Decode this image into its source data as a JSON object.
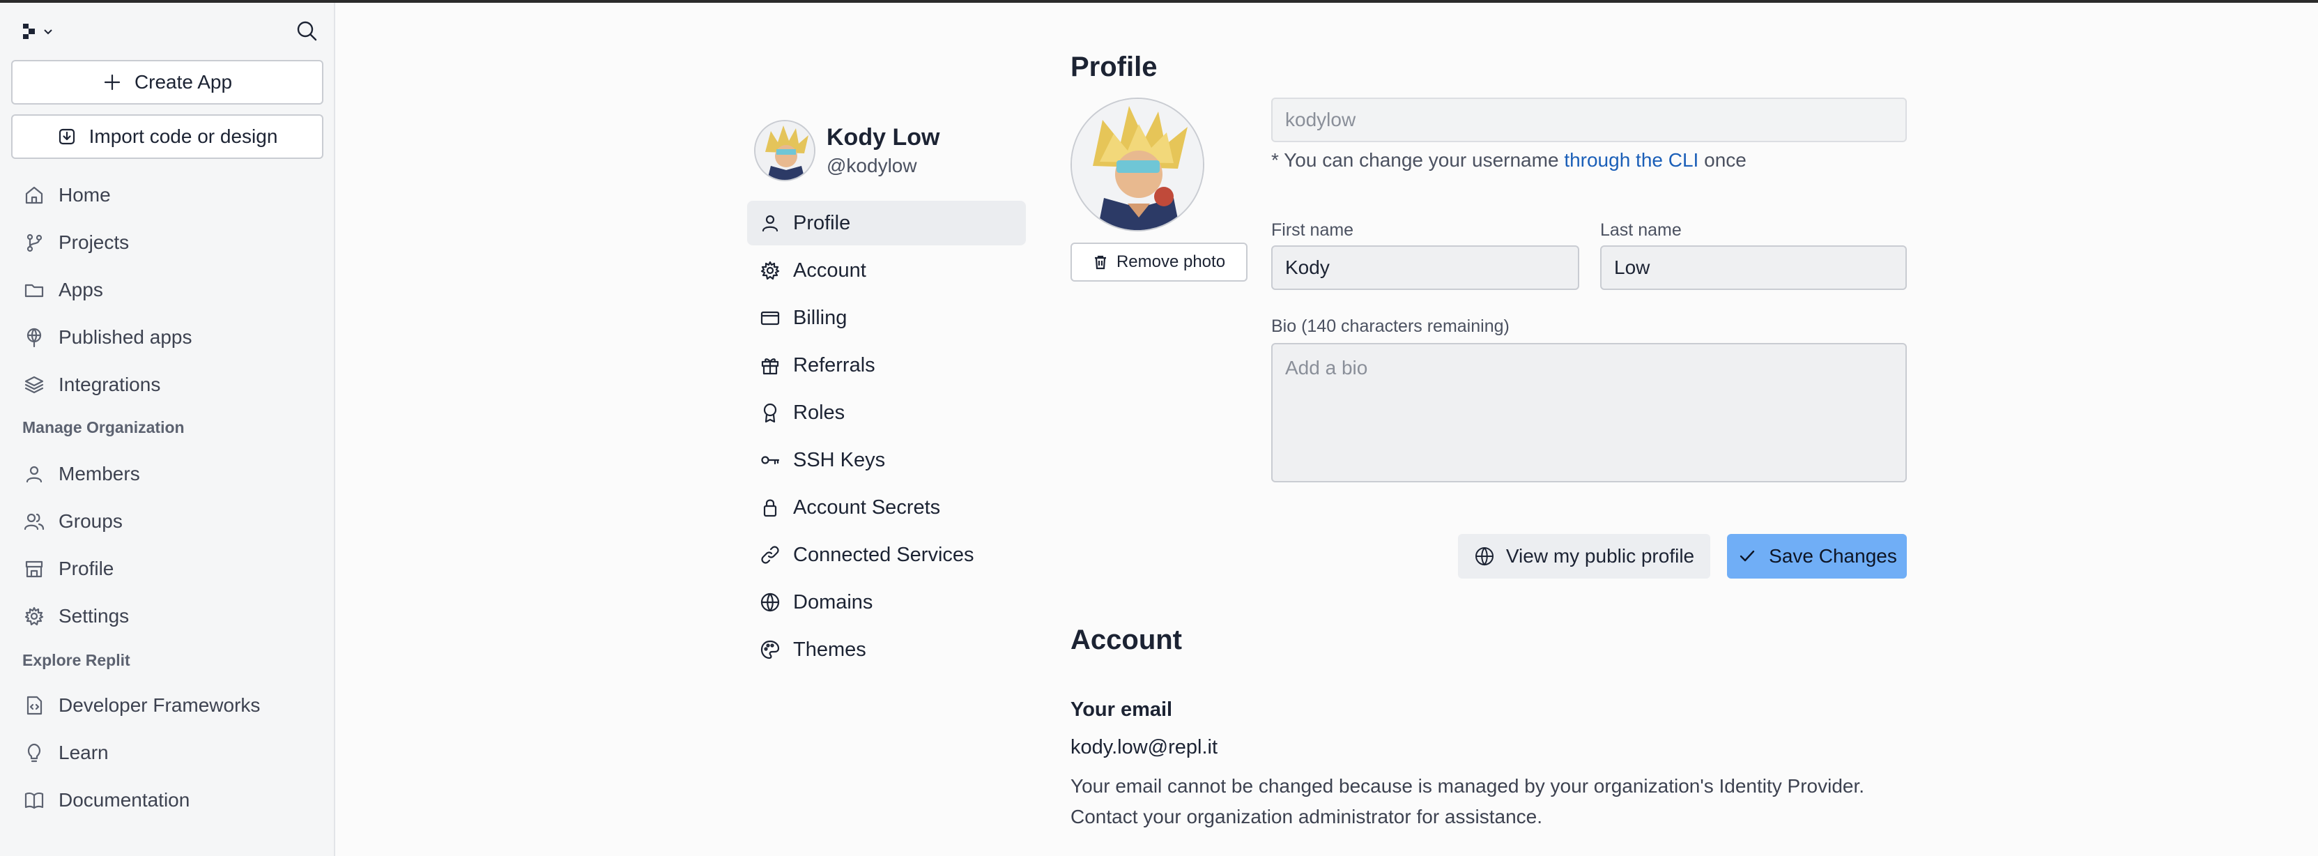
{
  "sidebar": {
    "create_app": "Create App",
    "import": "Import code or design",
    "nav": [
      {
        "label": "Home",
        "icon": "home-icon"
      },
      {
        "label": "Projects",
        "icon": "branch-icon"
      },
      {
        "label": "Apps",
        "icon": "folder-icon"
      },
      {
        "label": "Published apps",
        "icon": "globe-pin-icon"
      },
      {
        "label": "Integrations",
        "icon": "layers-icon"
      }
    ],
    "section_manage": "Manage Organization",
    "manage": [
      {
        "label": "Members",
        "icon": "user-icon"
      },
      {
        "label": "Groups",
        "icon": "users-icon"
      },
      {
        "label": "Profile",
        "icon": "storefront-icon"
      },
      {
        "label": "Settings",
        "icon": "gear-icon"
      }
    ],
    "section_explore": "Explore Replit",
    "explore": [
      {
        "label": "Developer Frameworks",
        "icon": "file-code-icon"
      },
      {
        "label": "Learn",
        "icon": "lightbulb-icon"
      },
      {
        "label": "Documentation",
        "icon": "book-icon"
      }
    ]
  },
  "user": {
    "name": "Kody Low",
    "handle": "@kodylow"
  },
  "settings_nav": [
    {
      "label": "Profile",
      "icon": "user-icon",
      "active": true
    },
    {
      "label": "Account",
      "icon": "gear-icon"
    },
    {
      "label": "Billing",
      "icon": "credit-card-icon"
    },
    {
      "label": "Referrals",
      "icon": "gift-icon"
    },
    {
      "label": "Roles",
      "icon": "badge-icon"
    },
    {
      "label": "SSH Keys",
      "icon": "key-icon"
    },
    {
      "label": "Account Secrets",
      "icon": "lock-icon"
    },
    {
      "label": "Connected Services",
      "icon": "link-icon"
    },
    {
      "label": "Domains",
      "icon": "globe-icon"
    },
    {
      "label": "Themes",
      "icon": "palette-icon"
    }
  ],
  "profile": {
    "title": "Profile",
    "username": "kodylow",
    "hint_prefix": "* You can change your username ",
    "hint_link": "through the CLI",
    "hint_suffix": " once",
    "remove_photo": "Remove photo",
    "first_name_label": "First name",
    "first_name": "Kody",
    "last_name_label": "Last name",
    "last_name": "Low",
    "bio_label": "Bio (140 characters remaining)",
    "bio_placeholder": "Add a bio",
    "view_public": "View my public profile",
    "save": "Save Changes"
  },
  "account": {
    "title": "Account",
    "email_label": "Your email",
    "email": "kody.low@repl.it",
    "note_line1": "Your email cannot be changed because is managed by your organization's Identity Provider.",
    "note_line2": "Contact your organization administrator for assistance."
  },
  "colors": {
    "accent": "#70aef6",
    "link": "#1b5fb8"
  }
}
